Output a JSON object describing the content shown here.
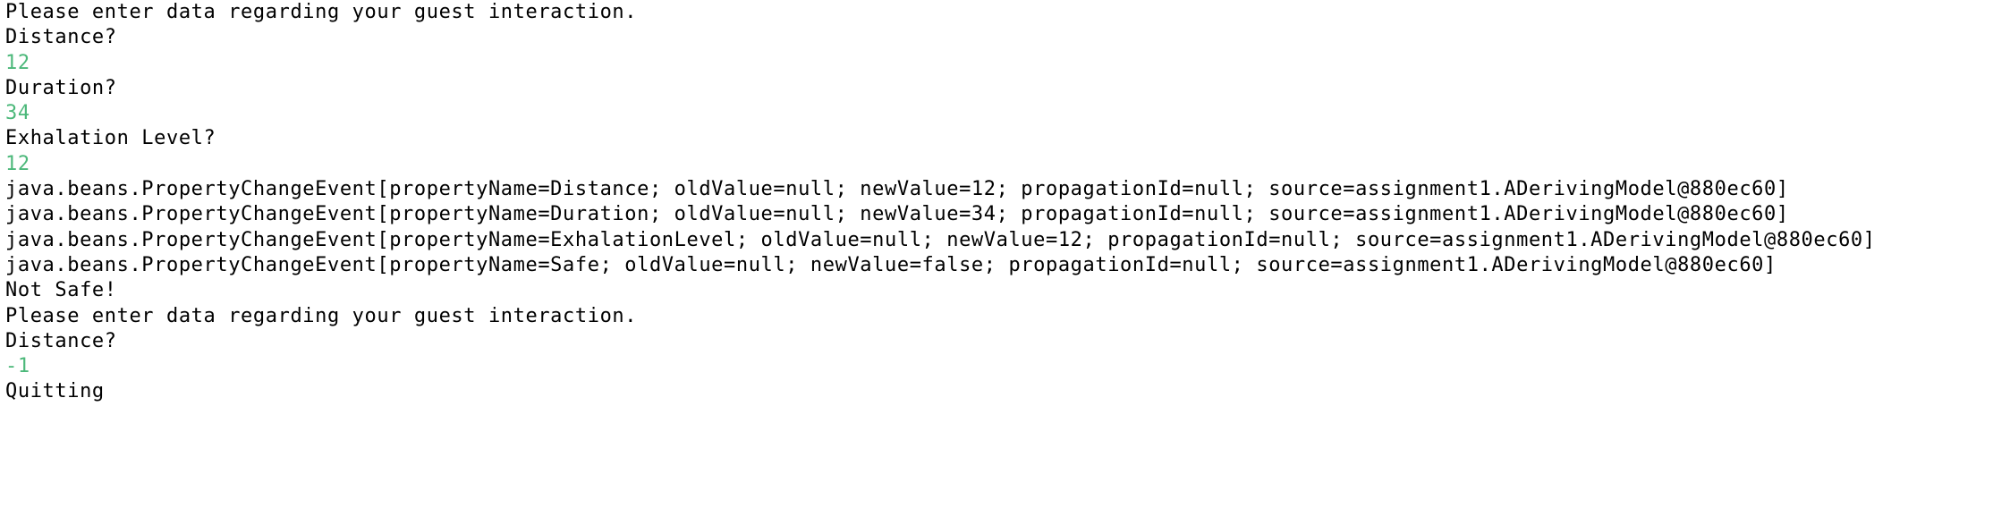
{
  "console": {
    "lines": [
      {
        "kind": "output",
        "text": "Please enter data regarding your guest interaction."
      },
      {
        "kind": "output",
        "text": "Distance?"
      },
      {
        "kind": "input",
        "text": "12"
      },
      {
        "kind": "output",
        "text": "Duration?"
      },
      {
        "kind": "input",
        "text": "34"
      },
      {
        "kind": "output",
        "text": "Exhalation Level?"
      },
      {
        "kind": "input",
        "text": "12"
      },
      {
        "kind": "output",
        "text": "java.beans.PropertyChangeEvent[propertyName=Distance; oldValue=null; newValue=12; propagationId=null; source=assignment1.ADerivingModel@880ec60]"
      },
      {
        "kind": "output",
        "text": "java.beans.PropertyChangeEvent[propertyName=Duration; oldValue=null; newValue=34; propagationId=null; source=assignment1.ADerivingModel@880ec60]"
      },
      {
        "kind": "output",
        "text": "java.beans.PropertyChangeEvent[propertyName=ExhalationLevel; oldValue=null; newValue=12; propagationId=null; source=assignment1.ADerivingModel@880ec60]"
      },
      {
        "kind": "output",
        "text": "java.beans.PropertyChangeEvent[propertyName=Safe; oldValue=null; newValue=false; propagationId=null; source=assignment1.ADerivingModel@880ec60]"
      },
      {
        "kind": "output",
        "text": "Not Safe!"
      },
      {
        "kind": "output",
        "text": "Please enter data regarding your guest interaction."
      },
      {
        "kind": "output",
        "text": "Distance?"
      },
      {
        "kind": "input",
        "text": "-1"
      },
      {
        "kind": "output",
        "text": "Quitting"
      }
    ],
    "colors": {
      "output": "#000000",
      "input": "#4cb87a",
      "background": "#ffffff"
    }
  }
}
